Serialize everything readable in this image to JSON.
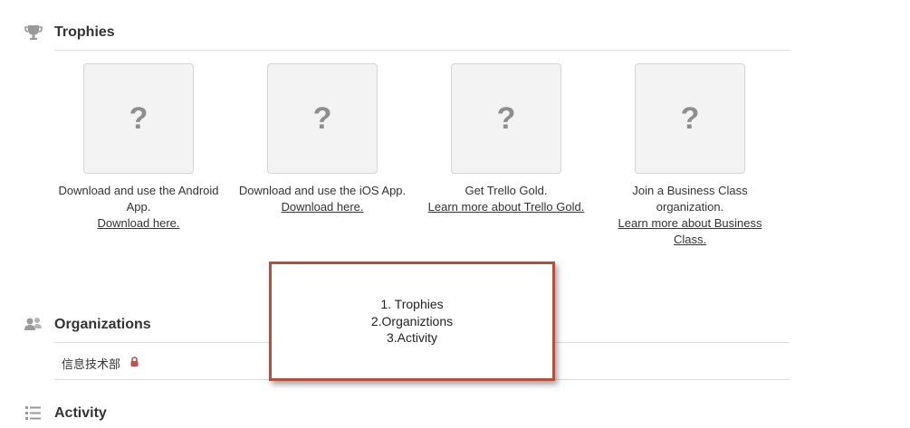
{
  "trophies": {
    "title": "Trophies",
    "items": [
      {
        "placeholder": "?",
        "description": "Download and use the Android App.",
        "link": "Download here."
      },
      {
        "placeholder": "?",
        "description": "Download and use the iOS App.",
        "link": "Download here."
      },
      {
        "placeholder": "?",
        "description": "Get Trello Gold.",
        "link": "Learn more about Trello Gold."
      },
      {
        "placeholder": "?",
        "description": "Join a Business Class organization.",
        "link": "Learn more about Business Class."
      }
    ]
  },
  "organizations": {
    "title": "Organizations",
    "items": [
      {
        "name": "信息技术部",
        "private": true
      }
    ]
  },
  "activity": {
    "title": "Activity"
  },
  "annotation": {
    "lines": [
      "1. Trophies",
      "2.Organiztions",
      "3.Activity"
    ],
    "border_color": "#b5503a"
  },
  "icons": {
    "trophies": "trophy-icon",
    "organizations": "members-icon",
    "activity": "activity-list-icon",
    "lock": "lock-icon"
  }
}
